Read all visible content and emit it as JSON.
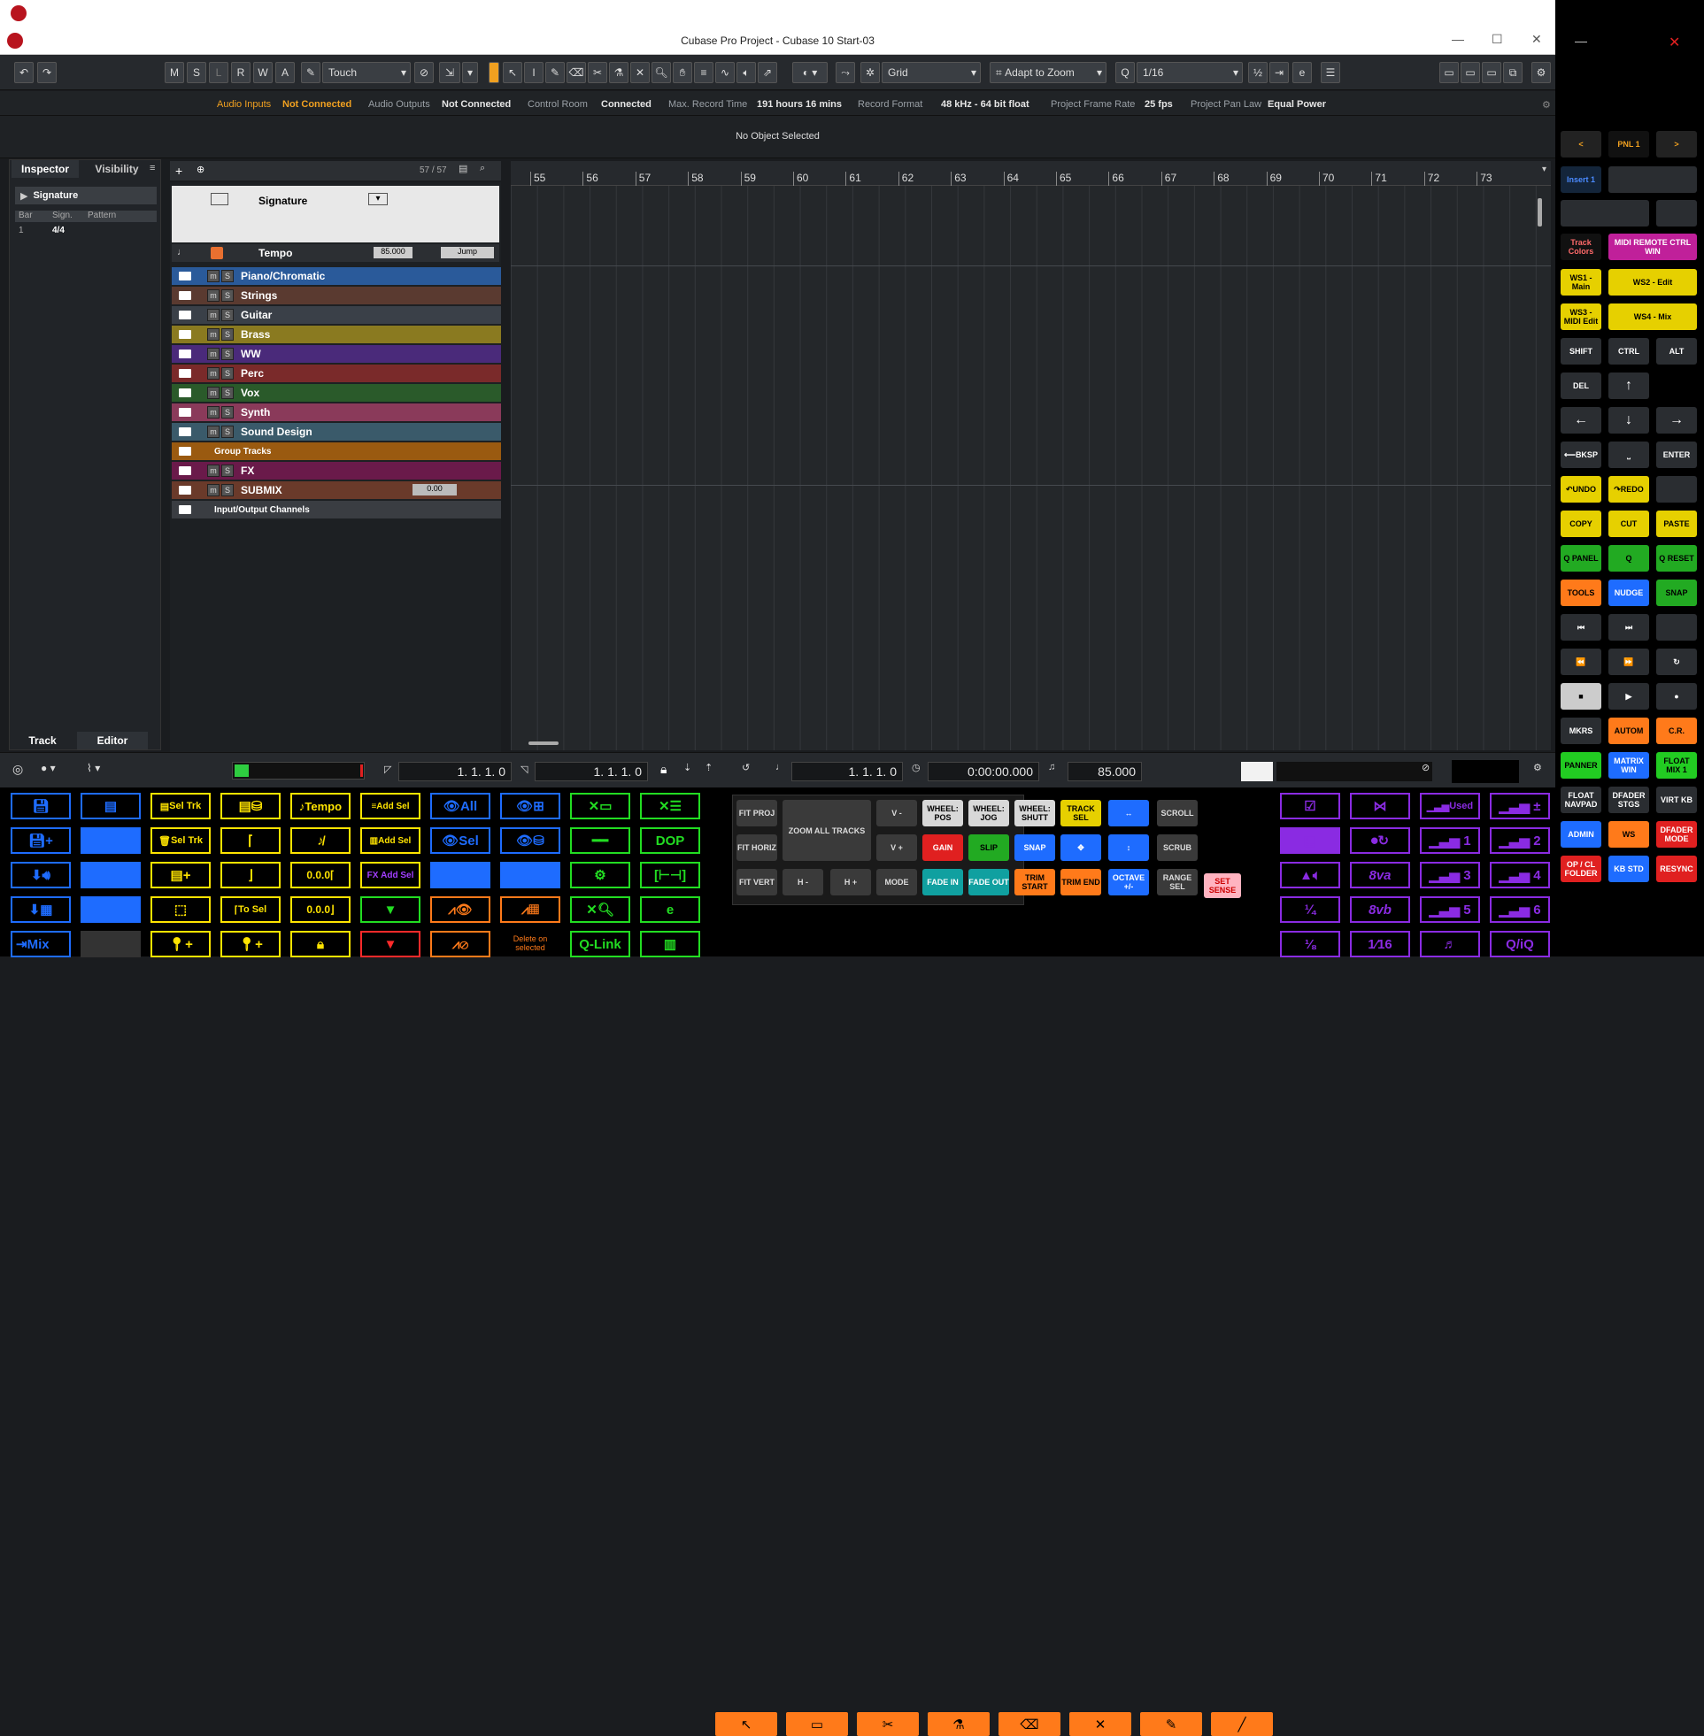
{
  "window": {
    "title": "Cubase Pro Project - Cubase 10 Start-03"
  },
  "toolbar": {
    "ms_buttons": [
      "M",
      "S",
      "L",
      "R",
      "W",
      "A"
    ],
    "automation_mode": "Touch",
    "snap_type": "Grid",
    "zoom_mode": "Adapt to Zoom",
    "quantize": "1/16"
  },
  "infobar": {
    "audio_inputs_label": "Audio Inputs",
    "audio_inputs_value": "Not Connected",
    "audio_outputs_label": "Audio Outputs",
    "audio_outputs_value": "Not Connected",
    "control_room_label": "Control Room",
    "control_room_value": "Connected",
    "max_record_label": "Max. Record Time",
    "max_record_value": "191 hours 16 mins",
    "record_format_label": "Record Format",
    "record_format_value": "48 kHz - 64 bit float",
    "frame_rate_label": "Project Frame Rate",
    "frame_rate_value": "25 fps",
    "pan_law_label": "Project Pan Law",
    "pan_law_value": "Equal Power"
  },
  "objbar": {
    "status": "No Object Selected"
  },
  "inspector": {
    "tab_inspector": "Inspector",
    "tab_visibility": "Visibility",
    "section": "Signature",
    "col_bar": "Bar",
    "col_sign": "Sign.",
    "col_pattern": "Pattern",
    "row_bar": "1",
    "row_sign": "4/4",
    "tab_track": "Track",
    "tab_editor": "Editor"
  },
  "tracklist": {
    "count": "57 / 57",
    "signature_track": "Signature",
    "tempo_track": "Tempo",
    "tempo_value": "85.000",
    "tempo_jump": "Jump",
    "tracks": [
      {
        "name": "Piano/Chromatic",
        "color": "#2a5a9a"
      },
      {
        "name": "Strings",
        "color": "#5a3a30"
      },
      {
        "name": "Guitar",
        "color": "#3a4048"
      },
      {
        "name": "Brass",
        "color": "#8a7a20"
      },
      {
        "name": "WW",
        "color": "#4a2a7a"
      },
      {
        "name": "Perc",
        "color": "#7a2a2a"
      },
      {
        "name": "Vox",
        "color": "#2a5a2a"
      },
      {
        "name": "Synth",
        "color": "#8a3a5a"
      },
      {
        "name": "Sound Design",
        "color": "#3a5a6a"
      },
      {
        "name": "Group Tracks",
        "color": "#9a5a10"
      },
      {
        "name": "FX",
        "color": "#6a1a4a"
      },
      {
        "name": "SUBMIX",
        "color": "#6a3a2a"
      },
      {
        "name": "Input/Output Channels",
        "color": "#3a3d42"
      }
    ],
    "submix_value": "0.00"
  },
  "ruler": {
    "bars": [
      "55",
      "56",
      "57",
      "58",
      "59",
      "60",
      "61",
      "62",
      "63",
      "64",
      "65",
      "66",
      "67",
      "68",
      "69",
      "70",
      "71",
      "72",
      "73"
    ]
  },
  "transport": {
    "left_locator": "1. 1. 1. 0",
    "right_locator": "1. 1. 1. 0",
    "position": "1. 1. 1. 0",
    "time": "0:00:00.000",
    "tempo": "85.000"
  },
  "macros": {
    "tempo": "Tempo",
    "all": "All",
    "sel": "Sel",
    "add_sel": "Add Sel",
    "sel_trk": "Sel Trk",
    "to_sel": "To Sel",
    "dop": "DOP",
    "qlink": "Q-Link",
    "mix": "Mix",
    "fx": "FX",
    "delete_on_selected": "Delete on selected",
    "used": "Used",
    "eighth_va": "8va",
    "eighth_vb": "8vb",
    "q_iq": "Q/iQ",
    "quarter": "¼",
    "eighth": "⅛",
    "sixteenth": "1⁄16"
  },
  "commands": {
    "fit_proj": "FIT PROJ",
    "fit_horiz": "FIT HORIZ",
    "fit_vert": "FIT VERT",
    "zoom_all": "ZOOM ALL TRACKS",
    "v_minus": "V -",
    "v_plus": "V +",
    "h_minus": "H -",
    "h_plus": "H +",
    "mode": "MODE",
    "wheel_pos": "WHEEL: POS",
    "wheel_jog": "WHEEL: JOG",
    "wheel_shutt": "WHEEL: SHUTT",
    "track_sel": "TRACK SEL",
    "gain": "GAIN",
    "slip": "SLIP",
    "snap": "SNAP",
    "fade_in": "FADE IN",
    "fade_out": "FADE OUT",
    "trim_start": "TRIM START",
    "trim_end": "TRIM END",
    "octave": "OCTAVE +/-",
    "scroll": "SCROLL",
    "scrub": "SCRUB",
    "range_sel": "RANGE SEL",
    "set_sense": "SET SENSE"
  },
  "rpanel": {
    "pnl": "PNL 1",
    "insert": "Insert 1",
    "track_colors": "Track Colors",
    "midi_remote": "MIDI REMOTE CTRL WIN",
    "ws1": "WS1 - Main",
    "ws2": "WS2 - Edit",
    "ws3": "WS3 - MIDI Edit",
    "ws4": "WS4 - Mix",
    "shift": "SHIFT",
    "ctrl": "CTRL",
    "alt": "ALT",
    "del": "DEL",
    "bksp": "BKSP",
    "enter": "ENTER",
    "undo": "UNDO",
    "redo": "REDO",
    "copy": "COPY",
    "cut": "CUT",
    "paste": "PASTE",
    "q_panel": "Q PANEL",
    "q": "Q",
    "q_reset": "Q RESET",
    "tools": "TOOLS",
    "nudge": "NUDGE",
    "snap": "SNAP",
    "mkrs": "MKRS",
    "autom": "AUTOM",
    "cr": "C.R.",
    "panner": "PANNER",
    "matrix": "MATRIX WIN",
    "float_mix": "FLOAT MIX 1",
    "float_navpad": "FLOAT NAVPAD",
    "dfader_stgs": "DFADER STGS",
    "virt_kb": "VIRT KB",
    "admin": "ADMIN",
    "ws": "WS",
    "dfader_mode": "DFADER MODE",
    "opcl_folder": "OP / CL FOLDER",
    "kb_std": "KB STD",
    "resync": "RESYNC"
  }
}
